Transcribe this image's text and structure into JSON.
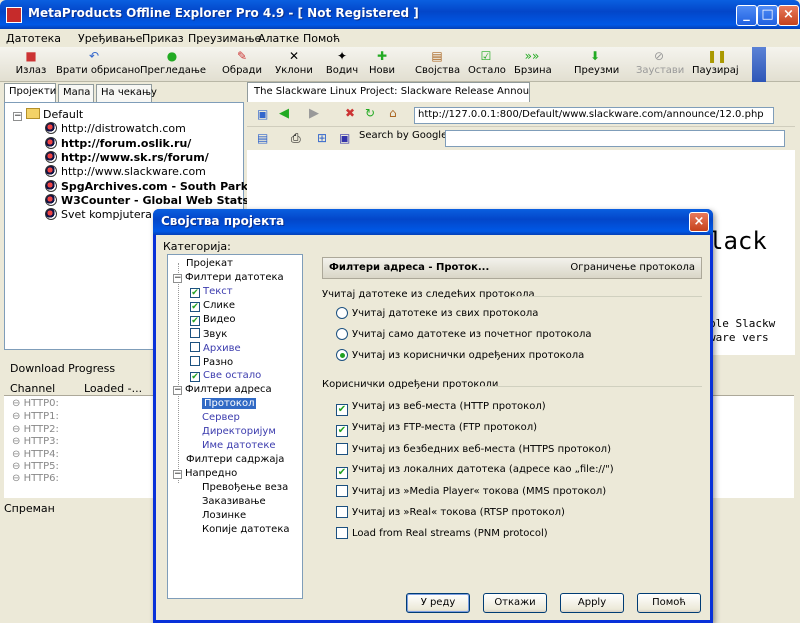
{
  "window": {
    "title": "MetaProducts Offline Explorer Pro 4.9 - [ Not Registered ]"
  },
  "menu": [
    "Датотека",
    "Уређивање",
    "Приказ",
    "Преузимање",
    "Алатке",
    "Помоћ"
  ],
  "toolbar": [
    {
      "label": "Излаз",
      "icon": "exit-icon"
    },
    {
      "label": "Врати обрисано",
      "icon": "undo-icon"
    },
    {
      "label": "Прегледање",
      "icon": "browse-icon"
    },
    {
      "label": "Обради",
      "icon": "edit-icon"
    },
    {
      "label": "Уклони",
      "icon": "delete-icon"
    },
    {
      "label": "Водич",
      "icon": "wizard-icon"
    },
    {
      "label": "Нови",
      "icon": "new-icon"
    },
    {
      "label": "Својства",
      "icon": "properties-icon"
    },
    {
      "label": "Остало",
      "icon": "other-icon"
    },
    {
      "label": "Брзина",
      "icon": "speed-icon"
    },
    {
      "label": "Преузми",
      "icon": "download-icon"
    },
    {
      "label": "Заустави",
      "icon": "stop-icon"
    },
    {
      "label": "Паузирај",
      "icon": "pause-icon"
    }
  ],
  "left_tabs": [
    "Пројекти",
    "Мапа",
    "На чекању"
  ],
  "projects": {
    "root": "Default",
    "items": [
      {
        "label": "http://distrowatch.com",
        "bold": false
      },
      {
        "label": "http://forum.oslik.ru/",
        "bold": true
      },
      {
        "label": "http://www.sk.rs/forum/",
        "bold": true
      },
      {
        "label": "http://www.slackware.com",
        "bold": false
      },
      {
        "label": "SpgArchives.com - South Park Gam",
        "bold": true
      },
      {
        "label": "W3Counter - Global Web Stats",
        "bold": true
      },
      {
        "label": "Svet kompjutera",
        "bold": false
      }
    ]
  },
  "download": {
    "title": "Download Progress",
    "col_channel": "Channel",
    "col_loaded": "Loaded -...",
    "rows": [
      "HTTP0:",
      "HTTP1:",
      "HTTP2:",
      "HTTP3:",
      "HTTP4:",
      "HTTP5:",
      "HTTP6:"
    ]
  },
  "status": "Спреман",
  "browser": {
    "tab": "The Slackware Linux Project: Slackware Release Announcement",
    "url": "http://127.0.0.1:800/Default/www.slackware.com/announce/12.0.php",
    "search_label": "Search by Google:",
    "page_heading": "lack",
    "page_line1": "ble Slackw",
    "page_line2": "ware vers"
  },
  "dialog": {
    "title": "Својства пројекта",
    "categories_label": "Категорија:",
    "tree": [
      {
        "label": "Пројекат",
        "level": 1,
        "type": "plain"
      },
      {
        "label": "Филтери датотека",
        "level": 1,
        "type": "expander"
      },
      {
        "label": "Текст",
        "level": 2,
        "type": "check",
        "checked": true,
        "link": true
      },
      {
        "label": "Слике",
        "level": 2,
        "type": "check",
        "checked": true,
        "link": false
      },
      {
        "label": "Видео",
        "level": 2,
        "type": "check",
        "checked": true,
        "link": false
      },
      {
        "label": "Звук",
        "level": 2,
        "type": "check",
        "checked": false,
        "link": false
      },
      {
        "label": "Архиве",
        "level": 2,
        "type": "check",
        "checked": false,
        "link": true
      },
      {
        "label": "Разно",
        "level": 2,
        "type": "check",
        "checked": false,
        "link": false
      },
      {
        "label": "Све остало",
        "level": 2,
        "type": "check",
        "checked": true,
        "link": true
      },
      {
        "label": "Филтери адреса",
        "level": 1,
        "type": "expander"
      },
      {
        "label": "Протокол",
        "level": 2,
        "type": "selected"
      },
      {
        "label": "Сервер",
        "level": 2,
        "type": "link"
      },
      {
        "label": "Директоријум",
        "level": 2,
        "type": "link"
      },
      {
        "label": "Име датотеке",
        "level": 2,
        "type": "link"
      },
      {
        "label": "Филтери садржаја",
        "level": 1,
        "type": "plain"
      },
      {
        "label": "Напредно",
        "level": 1,
        "type": "expander"
      },
      {
        "label": "Превођење веза",
        "level": 2,
        "type": "plain"
      },
      {
        "label": "Заказивање",
        "level": 2,
        "type": "plain"
      },
      {
        "label": "Лозинке",
        "level": 2,
        "type": "plain"
      },
      {
        "label": "Копије датотека",
        "level": 2,
        "type": "plain"
      }
    ],
    "panel_title": "Филтери адреса - Проток...",
    "panel_subtitle": "Ограничење протокола",
    "group1_title": "Учитај датотеке из следећих протокола",
    "radios": [
      {
        "label": "Учитај датотеке из свих протокола",
        "selected": false
      },
      {
        "label": "Учитај само датотеке из почетног протокола",
        "selected": false
      },
      {
        "label": "Учитај из кориснички одређених протокола",
        "selected": true
      }
    ],
    "group2_title": "Кориснички одређени протоколи",
    "checks": [
      {
        "label": "Учитај из веб-места (HTTP протокол)",
        "checked": true
      },
      {
        "label": "Учитај из FTP-места (FTP протокол)",
        "checked": true
      },
      {
        "label": "Учитај из безбедних веб-места (HTTPS протокол)",
        "checked": false
      },
      {
        "label": "Учитај из локалних датотека (адресе као „file://\")",
        "checked": true
      },
      {
        "label": "Учитај из »Media Player« токова (MMS протокол)",
        "checked": false
      },
      {
        "label": "Учитај из »Real« токова (RTSP протокол)",
        "checked": false
      },
      {
        "label": "Load from Real streams (PNM protocol)",
        "checked": false
      }
    ],
    "buttons": {
      "ok": "У реду",
      "cancel": "Откажи",
      "apply": "Apply",
      "help": "Помоћ"
    }
  }
}
